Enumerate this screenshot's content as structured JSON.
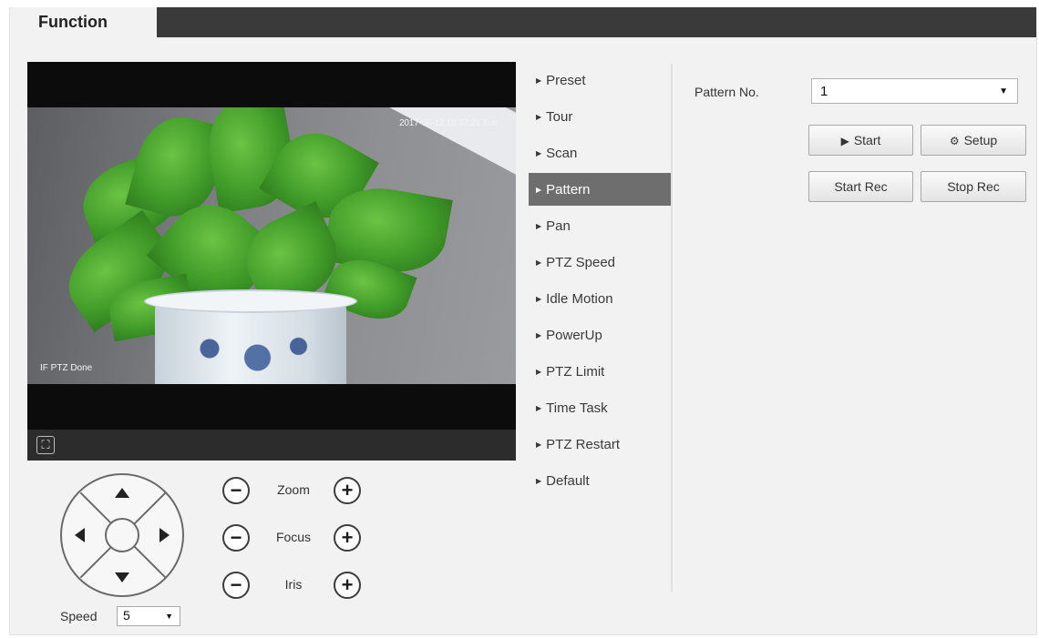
{
  "header": {
    "tab_label": "Function"
  },
  "video": {
    "osd_time": "2017-06-12 10:37:21 Tue",
    "osd_status": "IF PTZ Done"
  },
  "ptz": {
    "speed_label": "Speed",
    "speed_value": "5",
    "zoom_label": "Zoom",
    "focus_label": "Focus",
    "iris_label": "Iris",
    "minus_symbol": "−",
    "plus_symbol": "+"
  },
  "menu": {
    "items": [
      {
        "label": "Preset"
      },
      {
        "label": "Tour"
      },
      {
        "label": "Scan"
      },
      {
        "label": "Pattern"
      },
      {
        "label": "Pan"
      },
      {
        "label": "PTZ Speed"
      },
      {
        "label": "Idle Motion"
      },
      {
        "label": "PowerUp"
      },
      {
        "label": "PTZ Limit"
      },
      {
        "label": "Time Task"
      },
      {
        "label": "PTZ Restart"
      },
      {
        "label": "Default"
      }
    ],
    "active_index": 3
  },
  "pattern": {
    "label": "Pattern No.",
    "value": "1",
    "start_label": "Start",
    "setup_label": "Setup",
    "start_rec_label": "Start Rec",
    "stop_rec_label": "Stop Rec"
  },
  "icons": {
    "fullscreen": "fullscreen-icon",
    "play": "play-icon",
    "gear": "gear-icon",
    "menu_arrow": "triangle-right-icon",
    "dropdown": "chevron-down-icon"
  },
  "colors": {
    "header_bar": "#3a3a3a",
    "active_menu": "#6e6e6e",
    "panel_bg": "#f2f2f2"
  }
}
